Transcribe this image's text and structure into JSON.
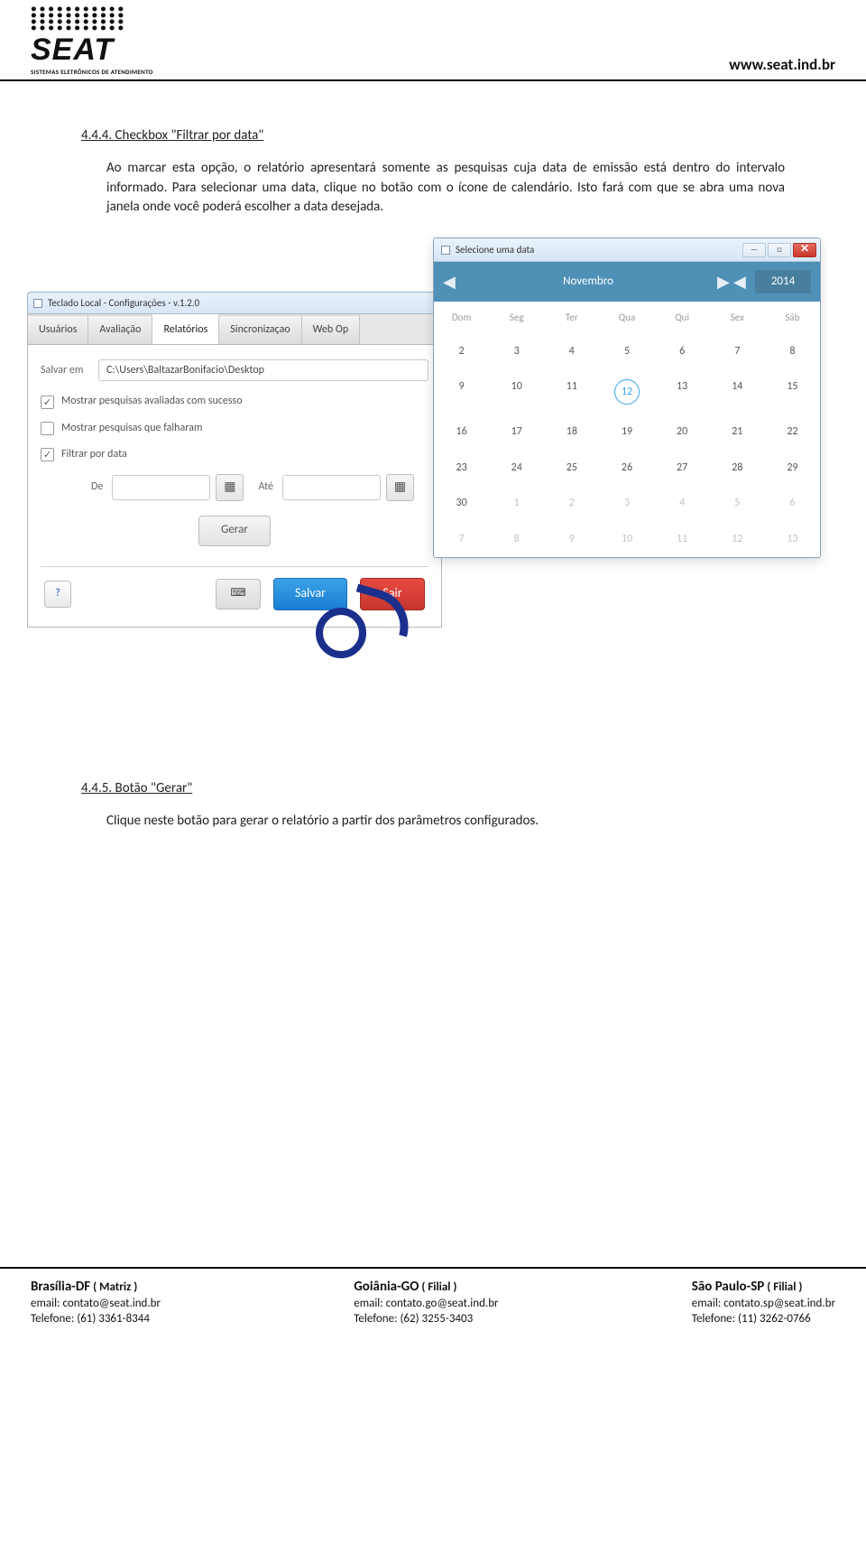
{
  "header": {
    "brand": "SEAT",
    "brand_sub": "SISTEMAS ELETRÔNICOS DE ATENDIMENTO",
    "site": "www.seat.ind.br"
  },
  "section1": {
    "title": "4.4.4. Checkbox \"Filtrar por data\"",
    "body": "Ao marcar esta opção, o relatório apresentará somente as pesquisas cuja data de emissão está dentro do intervalo informado. Para selecionar uma data, clique no botão com o ícone de calendário. Isto fará com que se abra uma nova janela onde você poderá escolher a data desejada."
  },
  "config_window": {
    "title": "Teclado Local - Configurações - v.1.2.0",
    "tabs": [
      "Usuários",
      "Avaliação",
      "Relatórios",
      "Sincronizaçao",
      "Web Op"
    ],
    "active_tab": "Relatórios",
    "salvar_em_label": "Salvar em",
    "salvar_em_value": "C:\\Users\\BaltazarBonifacio\\Desktop",
    "chk1": "Mostrar pesquisas avaliadas com sucesso",
    "chk2": "Mostrar pesquisas que falharam",
    "chk3": "Filtrar por data",
    "de_label": "De",
    "ate_label": "Até",
    "gerar": "Gerar",
    "salvar": "Salvar",
    "sair": "Sair",
    "help": "?"
  },
  "calendar": {
    "title": "Selecione uma data",
    "month": "Novembro",
    "year": "2014",
    "dow": [
      "Dom",
      "Seg",
      "Ter",
      "Qua",
      "Qui",
      "Sex",
      "Sáb"
    ],
    "rows": [
      [
        {
          "d": "2"
        },
        {
          "d": "3"
        },
        {
          "d": "4"
        },
        {
          "d": "5"
        },
        {
          "d": "6"
        },
        {
          "d": "7"
        },
        {
          "d": "8"
        }
      ],
      [
        {
          "d": "9"
        },
        {
          "d": "10"
        },
        {
          "d": "11"
        },
        {
          "d": "12",
          "sel": true
        },
        {
          "d": "13"
        },
        {
          "d": "14"
        },
        {
          "d": "15"
        }
      ],
      [
        {
          "d": "16"
        },
        {
          "d": "17"
        },
        {
          "d": "18"
        },
        {
          "d": "19"
        },
        {
          "d": "20"
        },
        {
          "d": "21"
        },
        {
          "d": "22"
        }
      ],
      [
        {
          "d": "23"
        },
        {
          "d": "24"
        },
        {
          "d": "25"
        },
        {
          "d": "26"
        },
        {
          "d": "27"
        },
        {
          "d": "28"
        },
        {
          "d": "29"
        }
      ],
      [
        {
          "d": "30"
        },
        {
          "d": "1",
          "mute": true
        },
        {
          "d": "2",
          "mute": true
        },
        {
          "d": "3",
          "mute": true
        },
        {
          "d": "4",
          "mute": true
        },
        {
          "d": "5",
          "mute": true
        },
        {
          "d": "6",
          "mute": true
        }
      ],
      [
        {
          "d": "7",
          "mute": true
        },
        {
          "d": "8",
          "mute": true
        },
        {
          "d": "9",
          "mute": true
        },
        {
          "d": "10",
          "mute": true
        },
        {
          "d": "11",
          "mute": true
        },
        {
          "d": "12",
          "mute": true
        },
        {
          "d": "13",
          "mute": true
        }
      ]
    ]
  },
  "section2": {
    "title": "4.4.5. Botão \"Gerar\"",
    "body": "Clique neste botão para gerar o relatório a partir dos parâmetros configurados."
  },
  "footer": {
    "col1": {
      "city": "Brasília-DF",
      "role": "( Matriz )",
      "email": "email: contato@seat.ind.br",
      "tel": "Telefone: (61) 3361-8344"
    },
    "col2": {
      "city": "Goiânia-GO",
      "role": "( Filial )",
      "email": "email: contato.go@seat.ind.br",
      "tel": "Telefone: (62) 3255-3403"
    },
    "col3": {
      "city": "São Paulo-SP",
      "role": "( Filial )",
      "email": "email: contato.sp@seat.ind.br",
      "tel": "Telefone: (11) 3262-0766"
    }
  }
}
